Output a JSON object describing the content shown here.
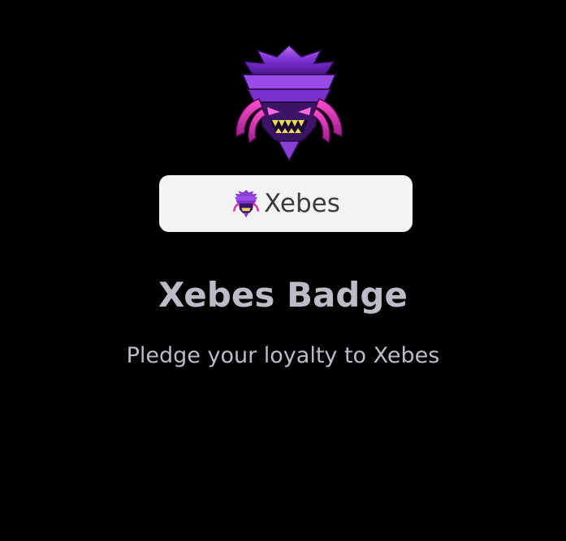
{
  "badge": {
    "pill_label": "Xebes",
    "title": "Xebes Badge",
    "description": "Pledge your loyalty to Xebes",
    "emblem_icon": "xebes-demon-mask-icon"
  },
  "colors": {
    "background": "#000000",
    "pill_background": "#f3f3f3",
    "pill_text": "#3c3c3c",
    "text": "#bdbcc6",
    "emblem_purple": "#8a3fd6",
    "emblem_magenta": "#e033b8",
    "emblem_teeth": "#d9c94a"
  }
}
